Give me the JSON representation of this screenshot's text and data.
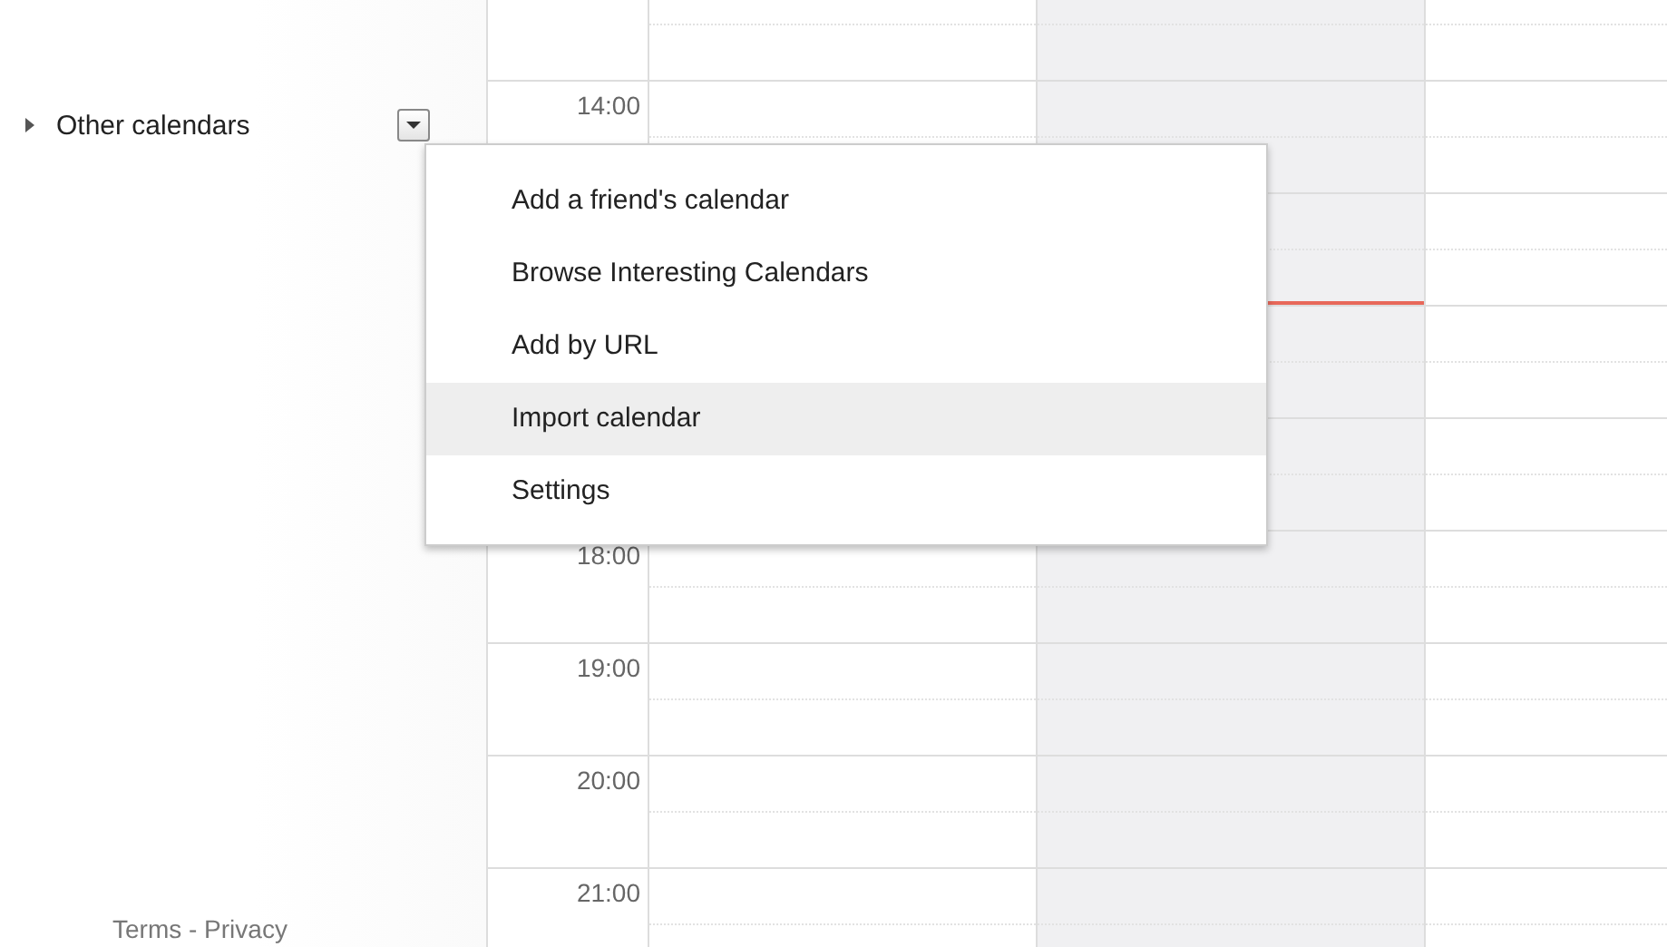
{
  "sidebar": {
    "section": {
      "label": "Other calendars",
      "expanded": false
    },
    "footer": "Terms - Privacy"
  },
  "menu": {
    "items": [
      {
        "label": "Add a friend's calendar",
        "selected": false
      },
      {
        "label": "Browse Interesting Calendars",
        "selected": false
      },
      {
        "label": "Add by URL",
        "selected": false
      },
      {
        "label": "Import calendar",
        "selected": true
      },
      {
        "label": "Settings",
        "selected": false
      }
    ]
  },
  "grid": {
    "days": [
      {
        "today": false
      },
      {
        "today": true
      },
      {
        "today": false
      }
    ],
    "rows": [
      {},
      {
        "label": "14:00"
      },
      {},
      {},
      {},
      {
        "label": "18:00"
      },
      {
        "label": "19:00"
      },
      {
        "label": "20:00"
      },
      {
        "label": "21:00"
      }
    ]
  }
}
